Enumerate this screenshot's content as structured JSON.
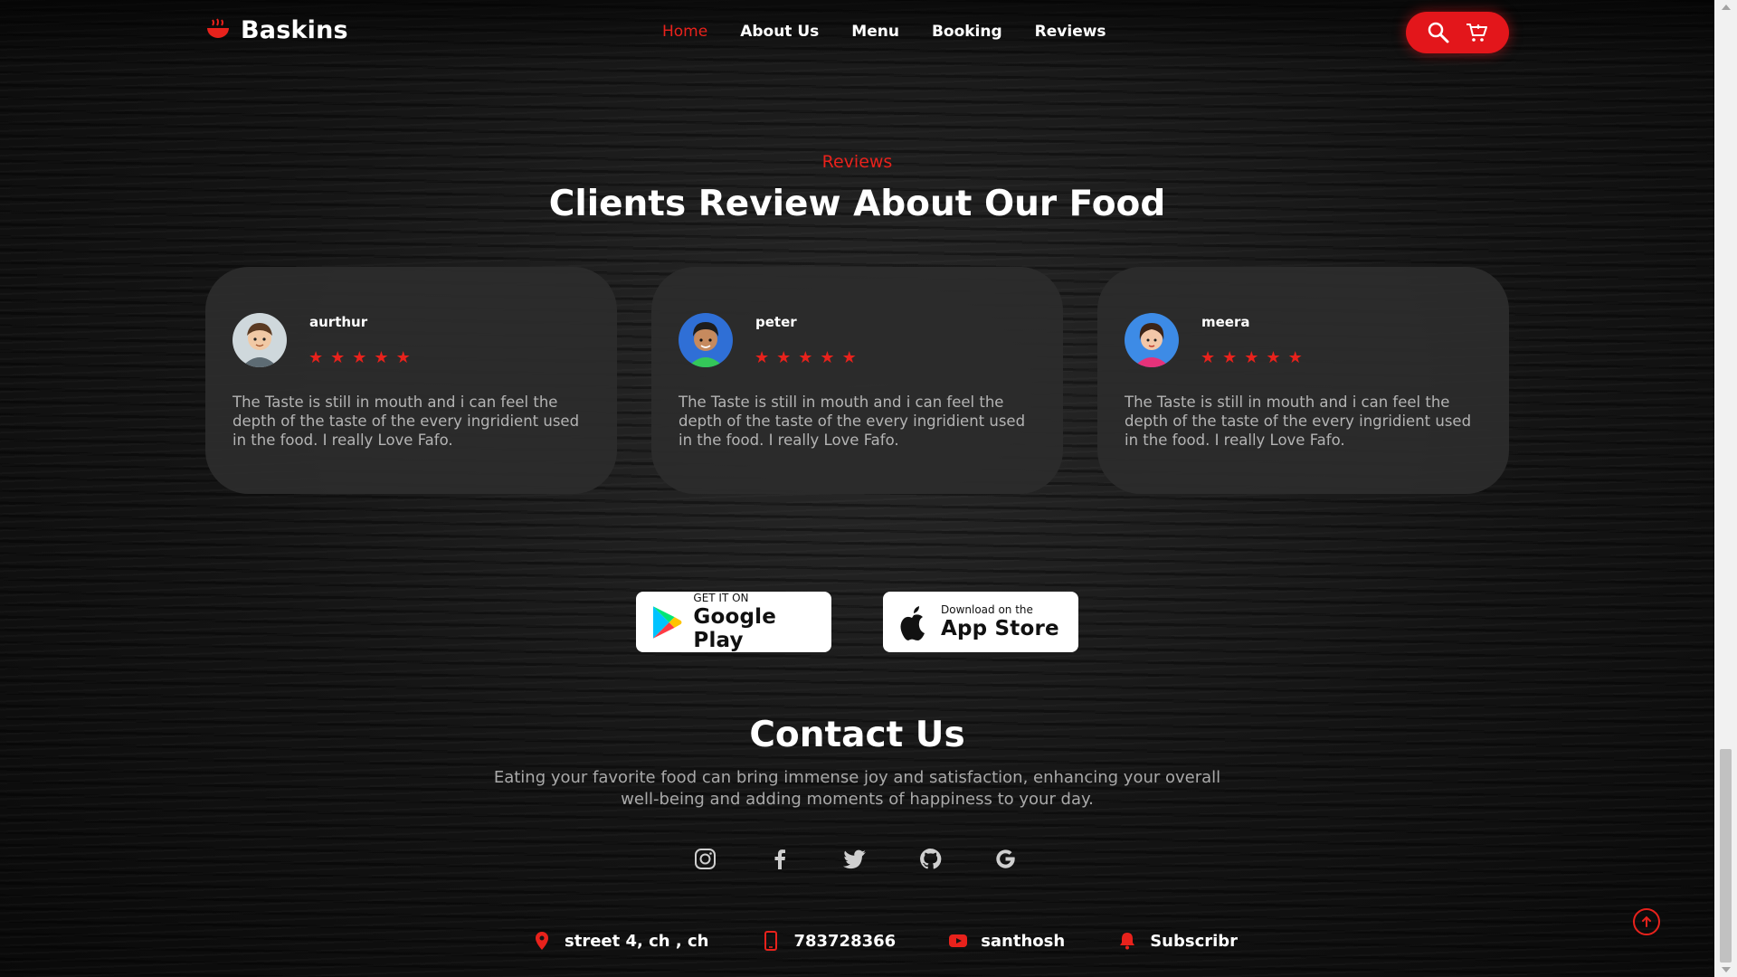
{
  "header": {
    "brand": "Baskins",
    "nav": [
      {
        "label": "Home",
        "active": true
      },
      {
        "label": "About Us",
        "active": false
      },
      {
        "label": "Menu",
        "active": false
      },
      {
        "label": "Booking",
        "active": false
      },
      {
        "label": "Reviews",
        "active": false
      }
    ],
    "actions": [
      "search-icon",
      "cart-icon"
    ]
  },
  "reviews": {
    "label": "Reviews",
    "title": "Clients Review About Our Food",
    "items": [
      {
        "name": "aurthur",
        "rating": 5,
        "text": "The Taste is still in mouth and i can feel the depth of the taste of the every ingridient used in the food. I really Love Fafo."
      },
      {
        "name": "peter",
        "rating": 5,
        "text": "The Taste is still in mouth and i can feel the depth of the taste of the every ingridient used in the food. I really Love Fafo."
      },
      {
        "name": "meera",
        "rating": 5,
        "text": "The Taste is still in mouth and i can feel the depth of the taste of the every ingridient used in the food. I really Love Fafo."
      }
    ],
    "star_glyph": "★"
  },
  "apps": {
    "google": {
      "small": "GET IT ON",
      "big": "Google Play"
    },
    "apple": {
      "small": "Download on the",
      "big": "App Store"
    }
  },
  "contact": {
    "title": "Contact Us",
    "description": "Eating your favorite food can bring immense joy and satisfaction, enhancing your overall well-being and adding moments of happiness to your day.",
    "socials": [
      "instagram-icon",
      "facebook-icon",
      "twitter-icon",
      "github-icon",
      "google-icon"
    ],
    "info": [
      {
        "icon": "location-icon",
        "text": "street 4, ch , ch"
      },
      {
        "icon": "phone-icon",
        "text": "783728366"
      },
      {
        "icon": "youtube-icon",
        "text": "santhosh"
      },
      {
        "icon": "bell-icon",
        "text": "Subscribr"
      }
    ]
  },
  "colors": {
    "accent": "#e8221c",
    "card": "#2c2c2c",
    "muted_text": "#b4b4b4"
  }
}
